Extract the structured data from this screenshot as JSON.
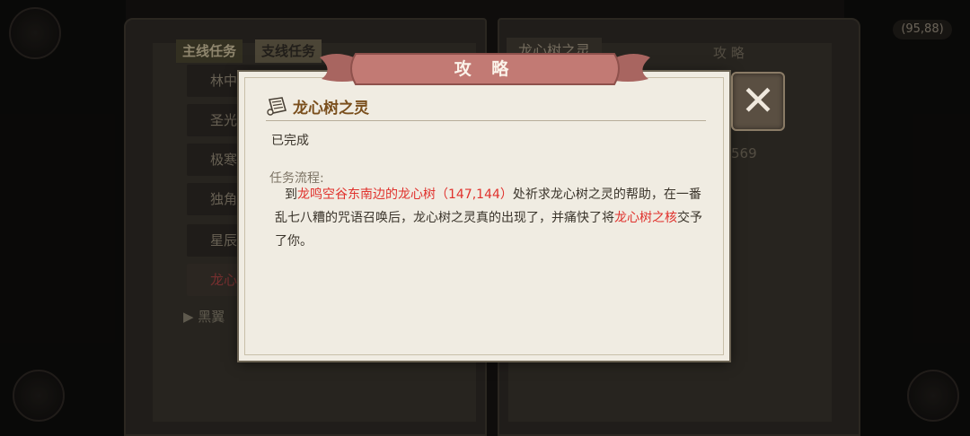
{
  "background": {
    "coords": "(95,88)"
  },
  "book": {
    "tabs": {
      "main": "主线任务",
      "side": "支线任务"
    },
    "quest_list": [
      {
        "label": "林中",
        "active": false
      },
      {
        "label": "圣光",
        "active": false
      },
      {
        "label": "极寒",
        "active": false
      },
      {
        "label": "独角",
        "active": false
      },
      {
        "label": "星辰",
        "active": false
      },
      {
        "label": "龙心",
        "active": true
      }
    ],
    "group_label": "▶ 黑翼",
    "right_title": "龙心树之灵",
    "right_guide": "攻 略",
    "right_num": "569"
  },
  "dialog": {
    "banner_title": "攻 略",
    "quest_name": "龙心树之灵",
    "status": "已完成",
    "flow_label": "任务流程:",
    "flow": {
      "prefix": "到",
      "location_highlight": "龙鸣空谷东南边的龙心树（147,144）",
      "middle": "处祈求龙心树之灵的帮助，在一番乱七八糟的咒语召唤后，龙心树之灵真的出现了，并痛快了将",
      "item_highlight": "龙心树之核",
      "suffix": "交予了你。"
    },
    "close_label": "✕"
  },
  "colors": {
    "highlight": "#e0322d",
    "banner": "#c27a74",
    "panel": "#f0ece2",
    "quest_name": "#7a4f1d"
  },
  "icons": {
    "scroll": "scroll-icon",
    "close": "close-icon"
  }
}
